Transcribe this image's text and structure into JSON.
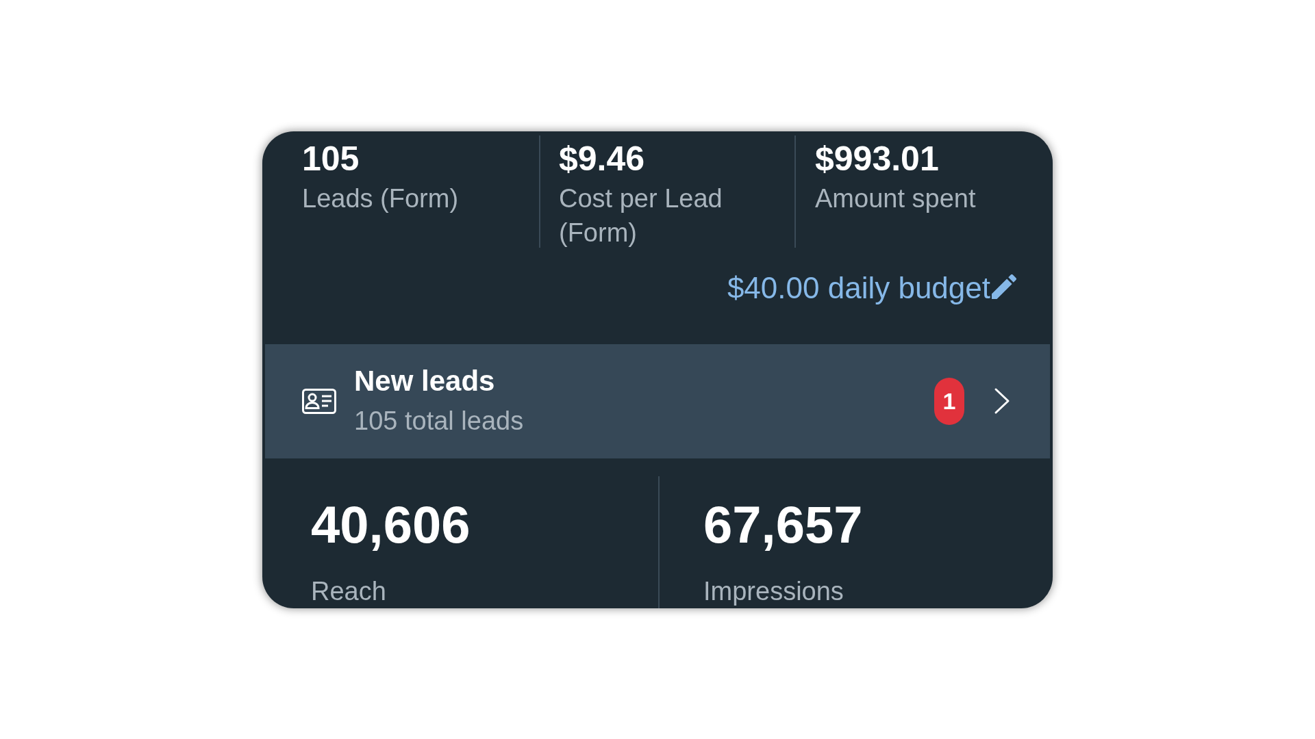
{
  "summary_metrics": [
    {
      "value": "105",
      "label": "Leads (Form)"
    },
    {
      "value": "$9.46",
      "label": "Cost per Lead (Form)"
    },
    {
      "value": "$993.01",
      "label": "Amount spent"
    }
  ],
  "budget_link": {
    "text": "$40.00 daily budget"
  },
  "leads_row": {
    "title": "New leads",
    "subtitle": "105 total leads",
    "badge": "1"
  },
  "bottom_metrics": [
    {
      "value": "40,606",
      "label": "Reach"
    },
    {
      "value": "67,657",
      "label": "Impressions"
    }
  ]
}
